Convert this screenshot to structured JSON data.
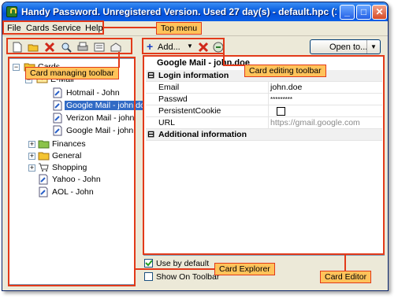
{
  "window": {
    "title": "Handy Password. Unregistered Version. Used 27 day(s) - default.hpc (10 c..."
  },
  "titlebar_buttons": {
    "minimize": "_",
    "maximize": "□",
    "close": "✕"
  },
  "menu": [
    "File",
    "Cards",
    "Service",
    "Help"
  ],
  "card_toolbar": {
    "icons": [
      "new-card-icon",
      "new-folder-icon",
      "delete-icon",
      "find-icon",
      "print-icon",
      "properties-icon",
      "fill-form-icon"
    ]
  },
  "edit_toolbar": {
    "add_label": "Add...",
    "open_label": "Open to..."
  },
  "tree": {
    "root": "Cards",
    "email": "E-Mail",
    "email_items": [
      "Hotmail - John",
      "Google Mail - john.doe",
      "Verizon Mail - john",
      "Google Mail - john"
    ],
    "folders": [
      "Finances",
      "General",
      "Shopping"
    ],
    "items": [
      "Yahoo - John",
      "AOL - John"
    ]
  },
  "editor": {
    "card_title": "Google Mail - john.doe",
    "login_section": "Login information",
    "fields": [
      {
        "key": "Email",
        "value": "john.doe"
      },
      {
        "key": "Passwd",
        "value": "*********"
      },
      {
        "key": "PersistentCookie",
        "value": ""
      },
      {
        "key": "URL",
        "value": "https://gmail.google.com"
      }
    ],
    "additional_section": "Additional information",
    "expander_minus": "⊟"
  },
  "options": {
    "use_default": "Use by default",
    "show_toolbar": "Show On Toolbar"
  },
  "callouts": {
    "top_menu": "Top menu",
    "card_toolbar": "Card managing toolbar",
    "edit_toolbar": "Card editing toolbar",
    "explorer": "Card Explorer",
    "editor": "Card Editor"
  },
  "colors": {
    "accent": "#316ac5",
    "callout_bg": "#ffc35a",
    "callout_border": "#e23a1a"
  }
}
